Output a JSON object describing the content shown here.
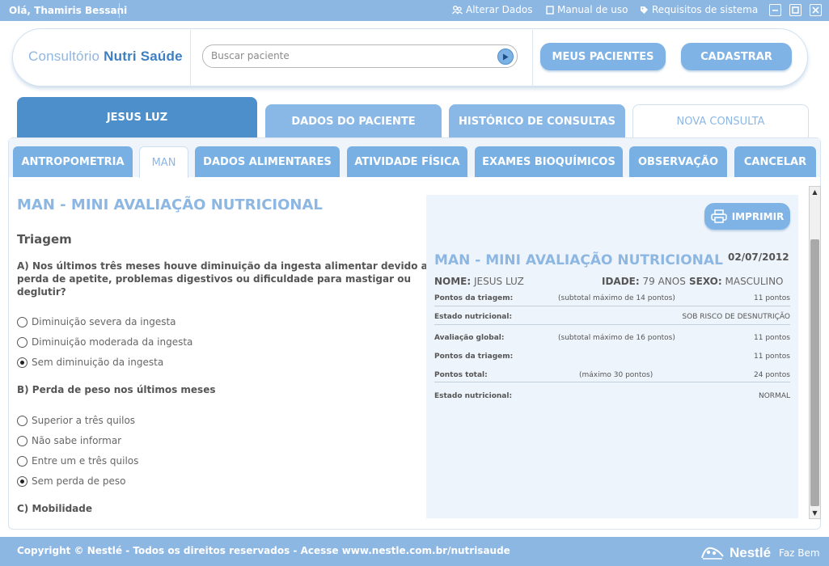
{
  "topbar": {
    "greeting": "Olá, Thamiris Bessani",
    "links": [
      {
        "label": "Alterar Dados",
        "icon": "users-icon"
      },
      {
        "label": "Manual de uso",
        "icon": "book-icon"
      },
      {
        "label": "Requisitos de sistema",
        "icon": "tag-icon"
      }
    ]
  },
  "header": {
    "logo_prefix": "Consultório",
    "logo_name": "Nutri Saúde",
    "search_placeholder": "Buscar paciente",
    "buttons": [
      "MEUS PACIENTES",
      "CADASTRAR"
    ]
  },
  "patient_tabs": {
    "active": "JESUS LUZ",
    "data": "DADOS DO PACIENTE",
    "history": "HISTÓRICO DE CONSULTAS",
    "new": "NOVA CONSULTA"
  },
  "subtabs": [
    "ANTROPOMETRIA",
    "MAN",
    "DADOS ALIMENTARES",
    "ATIVIDADE FÍSICA",
    "EXAMES BIOQUÍMICOS",
    "OBSERVAÇÃO",
    "CANCELAR"
  ],
  "form": {
    "title": "MAN - MINI AVALIAÇÃO NUTRICIONAL",
    "section": "Triagem",
    "q_a_lines": [
      "A) Nos últimos três meses houve diminuição da ingesta alimentar devido a",
      "perda de apetite, problemas digestivos ou dificuldade para mastigar ou",
      "deglutir?"
    ],
    "q_a_options": [
      {
        "label": "Diminuição severa da ingesta",
        "checked": false
      },
      {
        "label": "Diminuição moderada da ingesta",
        "checked": false
      },
      {
        "label": "Sem diminuição da ingesta",
        "checked": true
      }
    ],
    "q_b": "B) Perda de peso nos últimos meses",
    "q_b_options": [
      {
        "label": "Superior a três quilos",
        "checked": false
      },
      {
        "label": "Não sabe informar",
        "checked": false
      },
      {
        "label": "Entre um e três quilos",
        "checked": false
      },
      {
        "label": "Sem perda de peso",
        "checked": true
      }
    ],
    "q_c": "C) Mobilidade"
  },
  "report": {
    "print_label": "IMPRIMIR",
    "title": "MAN - MINI AVALIAÇÃO NUTRICIONAL",
    "date": "02/07/2012",
    "name_label": "NOME:",
    "name": "JESUS LUZ",
    "age_label": "IDADE:",
    "age": "79 ANOS",
    "sex_label": "SEXO:",
    "sex": "MASCULINO",
    "rows": [
      {
        "label": "Pontos da triagem:",
        "note": "(subtotal máximo de 14 pontos)",
        "value": "11 pontos"
      },
      {
        "label": "Estado nutricional:",
        "note": "",
        "value": "SOB RISCO DE DESNUTRIÇÃO"
      },
      {
        "label": "Avaliação global:",
        "note": "(subtotal máximo de 16 pontos)",
        "value": "11 pontos"
      },
      {
        "label": "Pontos da triagem:",
        "note": "",
        "value": "11 pontos"
      },
      {
        "label": "Pontos total:",
        "note": "(máximo 30 pontos)",
        "value": "24 pontos"
      },
      {
        "label": "Estado nutricional:",
        "note": "",
        "value": "NORMAL"
      }
    ]
  },
  "footer": {
    "copyright": "Copyright © Nestlé - Todos os direitos reservados - Acesse www.nestle.com.br/nutrisaude",
    "brand": "Nestlé",
    "tagline": "Faz Bem"
  },
  "colors": {
    "bar": "#8db7e3",
    "tab_active": "#4d8fcb",
    "tab": "#79b0e4",
    "title": "#8db7e3"
  }
}
